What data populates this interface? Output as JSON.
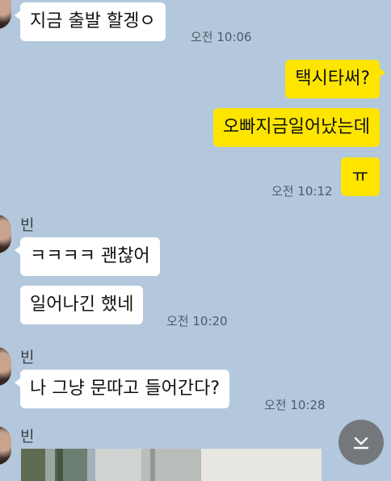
{
  "messages": [
    {
      "text": "지금 출발 할겡ㅇ",
      "time": "오전 10:06"
    },
    {
      "text": "택시타써?"
    },
    {
      "text": "오빠지금일어났는데"
    },
    {
      "text": "ㅠ",
      "time": "오전 10:12"
    },
    {
      "sender": "빈",
      "text": "ㅋㅋㅋㅋ 괜찮어"
    },
    {
      "text": "일어나긴 했네",
      "time": "오전 10:20"
    },
    {
      "sender": "빈",
      "text": "나 그냥 문따고 들어간다?",
      "time": "오전 10:28"
    },
    {
      "sender": "빈"
    }
  ],
  "colors": {
    "background": "#b3c8dc",
    "incoming_bubble": "#ffffff",
    "outgoing_bubble": "#fee500",
    "timestamp": "#4f5a66",
    "scroll_button": "#6f7276"
  },
  "icons": {
    "scroll_button": "chevron-down-to-bottom-icon"
  }
}
